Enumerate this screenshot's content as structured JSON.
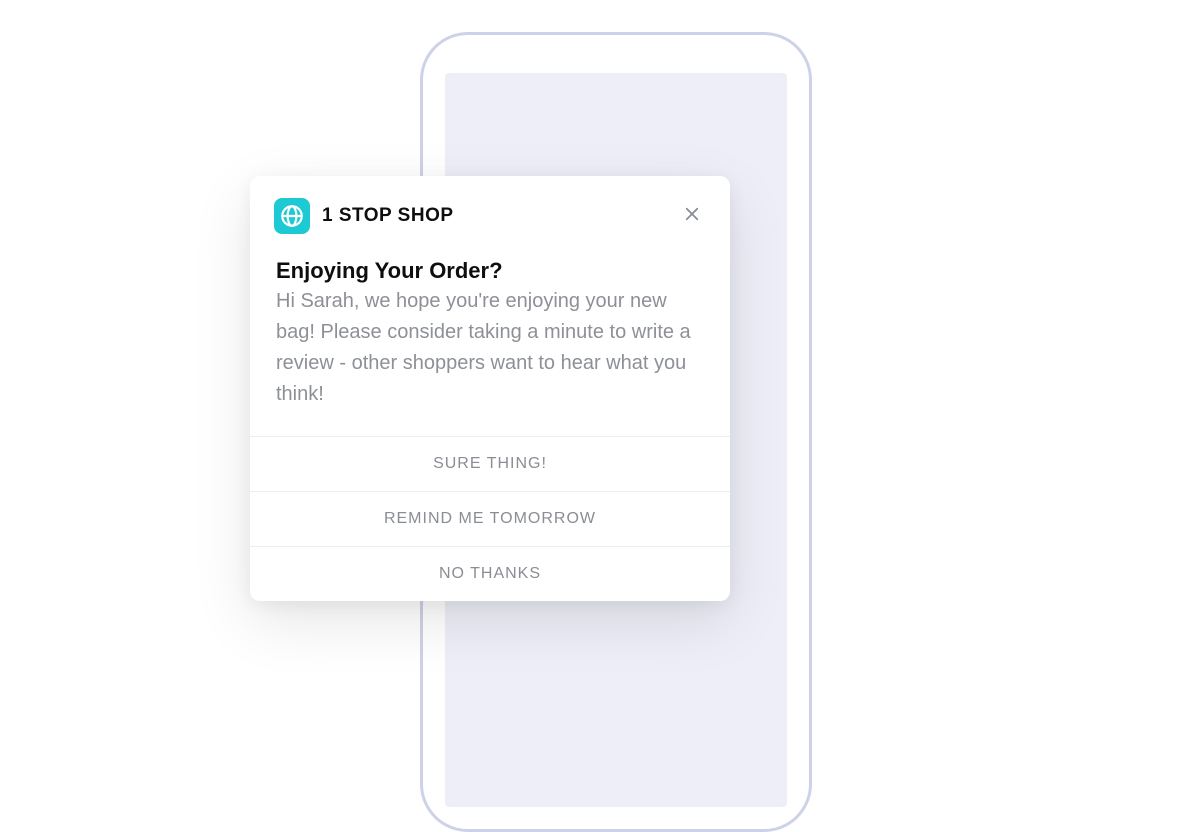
{
  "brand": {
    "name": "1 STOP SHOP",
    "accent_color": "#1dcad3"
  },
  "dialog": {
    "title": "Enjoying Your Order?",
    "message": "Hi Sarah, we hope you're enjoying your new bag! Please consider taking a minute to write a review - other shoppers want to hear what you think!",
    "actions": {
      "primary": "SURE THING!",
      "secondary": "REMIND ME TOMORROW",
      "dismiss": "NO THANKS"
    }
  }
}
